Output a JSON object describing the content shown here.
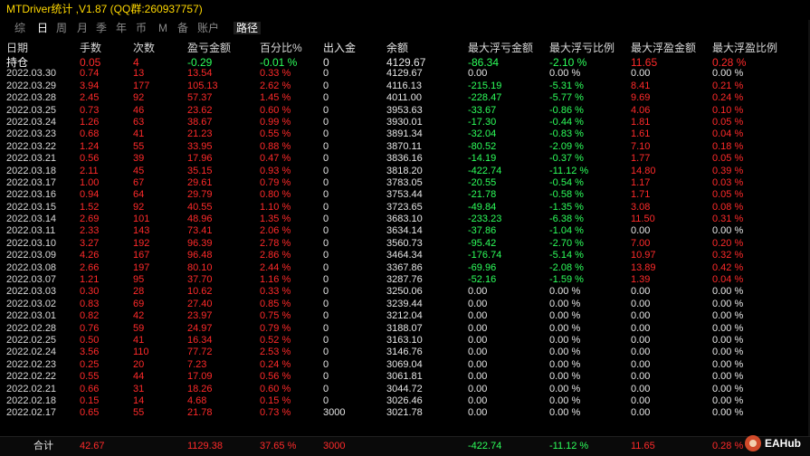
{
  "window": {
    "title": "MTDriver统计 ,V1.87 (QQ群:260937757)"
  },
  "tabs": [
    "综",
    "日",
    "周",
    "月",
    "季",
    "年",
    "币",
    "M",
    "备",
    "账户",
    "路径"
  ],
  "active_tab": "日",
  "columns": [
    "日期",
    "手数",
    "次数",
    "盈亏金额",
    "百分比%",
    "出入金",
    "余额",
    "最大浮亏金额",
    "最大浮亏比例",
    "最大浮盈金额",
    "最大浮盈比例"
  ],
  "rows": [
    [
      "持仓",
      "0.05",
      "4",
      "-0.29",
      "-0.01 %",
      "0",
      "4129.67",
      "-86.34",
      "-2.10 %",
      "11.65",
      "0.28 %"
    ],
    [
      "2022.03.30",
      "0.74",
      "13",
      "13.54",
      "0.33 %",
      "0",
      "4129.67",
      "0.00",
      "0.00 %",
      "0.00",
      "0.00 %"
    ],
    [
      "2022.03.29",
      "3.94",
      "177",
      "105.13",
      "2.62 %",
      "0",
      "4116.13",
      "-215.19",
      "-5.31 %",
      "8.41",
      "0.21 %"
    ],
    [
      "2022.03.28",
      "2.45",
      "92",
      "57.37",
      "1.45 %",
      "0",
      "4011.00",
      "-228.47",
      "-5.77 %",
      "9.69",
      "0.24 %"
    ],
    [
      "2022.03.25",
      "0.73",
      "46",
      "23.62",
      "0.60 %",
      "0",
      "3953.63",
      "-33.67",
      "-0.86 %",
      "4.06",
      "0.10 %"
    ],
    [
      "2022.03.24",
      "1.26",
      "63",
      "38.67",
      "0.99 %",
      "0",
      "3930.01",
      "-17.30",
      "-0.44 %",
      "1.81",
      "0.05 %"
    ],
    [
      "2022.03.23",
      "0.68",
      "41",
      "21.23",
      "0.55 %",
      "0",
      "3891.34",
      "-32.04",
      "-0.83 %",
      "1.61",
      "0.04 %"
    ],
    [
      "2022.03.22",
      "1.24",
      "55",
      "33.95",
      "0.88 %",
      "0",
      "3870.11",
      "-80.52",
      "-2.09 %",
      "7.10",
      "0.18 %"
    ],
    [
      "2022.03.21",
      "0.56",
      "39",
      "17.96",
      "0.47 %",
      "0",
      "3836.16",
      "-14.19",
      "-0.37 %",
      "1.77",
      "0.05 %"
    ],
    [
      "2022.03.18",
      "2.11",
      "45",
      "35.15",
      "0.93 %",
      "0",
      "3818.20",
      "-422.74",
      "-11.12 %",
      "14.80",
      "0.39 %"
    ],
    [
      "2022.03.17",
      "1.00",
      "67",
      "29.61",
      "0.79 %",
      "0",
      "3783.05",
      "-20.55",
      "-0.54 %",
      "1.17",
      "0.03 %"
    ],
    [
      "2022.03.16",
      "0.94",
      "64",
      "29.79",
      "0.80 %",
      "0",
      "3753.44",
      "-21.78",
      "-0.58 %",
      "1.71",
      "0.05 %"
    ],
    [
      "2022.03.15",
      "1.52",
      "92",
      "40.55",
      "1.10 %",
      "0",
      "3723.65",
      "-49.84",
      "-1.35 %",
      "3.08",
      "0.08 %"
    ],
    [
      "2022.03.14",
      "2.69",
      "101",
      "48.96",
      "1.35 %",
      "0",
      "3683.10",
      "-233.23",
      "-6.38 %",
      "11.50",
      "0.31 %"
    ],
    [
      "2022.03.11",
      "2.33",
      "143",
      "73.41",
      "2.06 %",
      "0",
      "3634.14",
      "-37.86",
      "-1.04 %",
      "0.00",
      "0.00 %"
    ],
    [
      "2022.03.10",
      "3.27",
      "192",
      "96.39",
      "2.78 %",
      "0",
      "3560.73",
      "-95.42",
      "-2.70 %",
      "7.00",
      "0.20 %"
    ],
    [
      "2022.03.09",
      "4.26",
      "167",
      "96.48",
      "2.86 %",
      "0",
      "3464.34",
      "-176.74",
      "-5.14 %",
      "10.97",
      "0.32 %"
    ],
    [
      "2022.03.08",
      "2.66",
      "197",
      "80.10",
      "2.44 %",
      "0",
      "3367.86",
      "-69.96",
      "-2.08 %",
      "13.89",
      "0.42 %"
    ],
    [
      "2022.03.07",
      "1.21",
      "95",
      "37.70",
      "1.16 %",
      "0",
      "3287.76",
      "-52.16",
      "-1.59 %",
      "1.39",
      "0.04 %"
    ],
    [
      "2022.03.03",
      "0.30",
      "28",
      "10.62",
      "0.33 %",
      "0",
      "3250.06",
      "0.00",
      "0.00 %",
      "0.00",
      "0.00 %"
    ],
    [
      "2022.03.02",
      "0.83",
      "69",
      "27.40",
      "0.85 %",
      "0",
      "3239.44",
      "0.00",
      "0.00 %",
      "0.00",
      "0.00 %"
    ],
    [
      "2022.03.01",
      "0.82",
      "42",
      "23.97",
      "0.75 %",
      "0",
      "3212.04",
      "0.00",
      "0.00 %",
      "0.00",
      "0.00 %"
    ],
    [
      "2022.02.28",
      "0.76",
      "59",
      "24.97",
      "0.79 %",
      "0",
      "3188.07",
      "0.00",
      "0.00 %",
      "0.00",
      "0.00 %"
    ],
    [
      "2022.02.25",
      "0.50",
      "41",
      "16.34",
      "0.52 %",
      "0",
      "3163.10",
      "0.00",
      "0.00 %",
      "0.00",
      "0.00 %"
    ],
    [
      "2022.02.24",
      "3.56",
      "110",
      "77.72",
      "2.53 %",
      "0",
      "3146.76",
      "0.00",
      "0.00 %",
      "0.00",
      "0.00 %"
    ],
    [
      "2022.02.23",
      "0.25",
      "20",
      "7.23",
      "0.24 %",
      "0",
      "3069.04",
      "0.00",
      "0.00 %",
      "0.00",
      "0.00 %"
    ],
    [
      "2022.02.22",
      "0.55",
      "44",
      "17.09",
      "0.56 %",
      "0",
      "3061.81",
      "0.00",
      "0.00 %",
      "0.00",
      "0.00 %"
    ],
    [
      "2022.02.21",
      "0.66",
      "31",
      "18.26",
      "0.60 %",
      "0",
      "3044.72",
      "0.00",
      "0.00 %",
      "0.00",
      "0.00 %"
    ],
    [
      "2022.02.18",
      "0.15",
      "14",
      "4.68",
      "0.15 %",
      "0",
      "3026.46",
      "0.00",
      "0.00 %",
      "0.00",
      "0.00 %"
    ],
    [
      "2022.02.17",
      "0.65",
      "55",
      "21.78",
      "0.73 %",
      "3000",
      "3021.78",
      "0.00",
      "0.00 %",
      "0.00",
      "0.00 %"
    ]
  ],
  "summary": [
    "合计",
    "42.67",
    "",
    "1129.38",
    "37.65 %",
    "3000",
    "",
    "-422.74",
    "-11.12 %",
    "11.65",
    "0.28 %"
  ],
  "logo": {
    "text": "EAHub"
  },
  "colors": {
    "title": "#ffd800",
    "positive": "#ff2a2a",
    "negative": "#2dff5b",
    "neutral": "#e6e6e6",
    "background": "#000000"
  }
}
